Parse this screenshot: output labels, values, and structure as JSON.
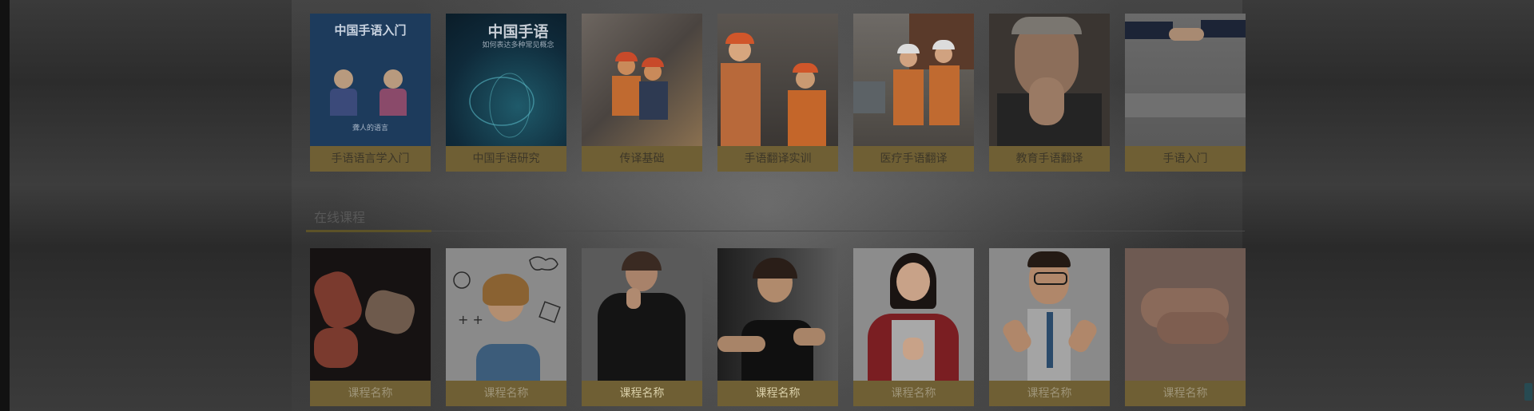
{
  "top_courses": [
    {
      "caption": "手语语言学入门",
      "image": "book-cover-sign-language-intro"
    },
    {
      "caption": "中国手语研究",
      "image": "book-cover-sign-language-research"
    },
    {
      "caption": "传译基础",
      "image": "industrial-workers-photo"
    },
    {
      "caption": "手语翻译实训",
      "image": "factory-workers-photo"
    },
    {
      "caption": "医疗手语翻译",
      "image": "port-workers-photo"
    },
    {
      "caption": "教育手语翻译",
      "image": "thinking-man-photo"
    },
    {
      "caption": "手语入门",
      "image": "handshake-photo"
    }
  ],
  "book_covers": {
    "cover_1": {
      "title": "中国手语入门",
      "subtitle": "聋人的语言"
    },
    "cover_2": {
      "title": "中国手语",
      "subtitle": "如何表达多种常见概念"
    }
  },
  "online_section": {
    "title": "在线课程"
  },
  "online_courses": [
    {
      "caption": "课程名称",
      "image": "signing-hands-photo"
    },
    {
      "caption": "课程名称",
      "image": "thinking-woman-sketch-photo"
    },
    {
      "caption": "课程名称",
      "image": "woman-signing-photo"
    },
    {
      "caption": "课程名称",
      "image": "girl-signing-photo"
    },
    {
      "caption": "课程名称",
      "image": "woman-red-jacket-signing-photo"
    },
    {
      "caption": "课程名称",
      "image": "cartoon-man-signing"
    },
    {
      "caption": "课程名称",
      "image": "hands-closeup-photo"
    }
  ],
  "colors": {
    "caption_bg": "#6f5f34",
    "overlay": "#2c2c2c",
    "accent": "#5c5228"
  }
}
